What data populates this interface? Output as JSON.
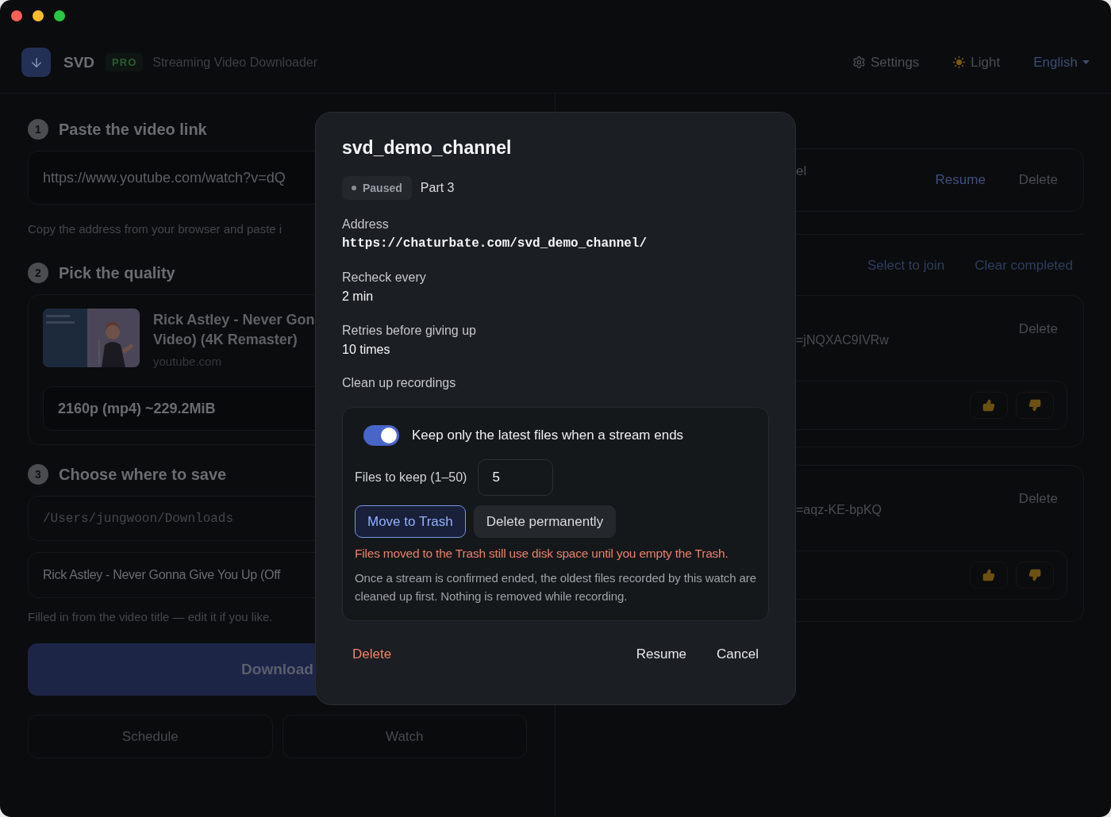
{
  "window": {
    "controls": [
      {
        "color": "#fe5f57"
      },
      {
        "color": "#febc2e"
      },
      {
        "color": "#28c840"
      }
    ]
  },
  "header": {
    "app_name": "SVD",
    "badge": "PRO",
    "tagline": "Streaming Video Downloader",
    "actions": [
      {
        "kind": "settings",
        "label": "Settings"
      },
      {
        "kind": "theme",
        "label": "Light"
      },
      {
        "kind": "language",
        "label": "English"
      }
    ]
  },
  "download_form": {
    "step_1": {
      "number": "1",
      "title": "Paste the video link",
      "url_value": "https://www.youtube.com/watch?v=dQ",
      "hint": "Copy the address from your browser and paste i"
    },
    "step_2": {
      "number": "2",
      "title": "Pick the quality",
      "video": {
        "thumbnail": {
          "kind": "picture"
        },
        "title_lines": [
          "Rick Astley - Never Gon",
          "Video) (4K Remaster)"
        ],
        "source": "youtube.com"
      },
      "format": "2160p (mp4) ~229.2MiB"
    },
    "step_3": {
      "number": "3",
      "title": "Choose where to save",
      "folder": "/Users/jungwoon/Downloads",
      "file_name": "Rick Astley - Never Gonna Give You Up (Off",
      "hint": "Filled in from the video title — edit it if you like."
    },
    "primary_button": "Download",
    "secondary_buttons": [
      "Schedule",
      "Watch"
    ]
  },
  "queue": {
    "watch_card": {
      "title_fragment": "el",
      "actions": [
        {
          "label": "Resume",
          "kind": "primary"
        },
        {
          "label": "Delete",
          "kind": "muted"
        }
      ]
    },
    "toolbar_actions": [
      "Select to join",
      "Clear completed"
    ],
    "items": [
      {
        "link_fragment": "=jNQXAC9IVRw",
        "action": "Delete"
      },
      {
        "link_fragment": "=aqz-KE-bpKQ",
        "action": "Delete"
      }
    ]
  },
  "dialog": {
    "title": "svd_demo_channel",
    "status": {
      "label": "Paused"
    },
    "part": "Part 3",
    "fields": [
      {
        "label": "Address",
        "value": "https://chaturbate.com/svd_demo_channel/",
        "kind": "mono"
      },
      {
        "label": "Recheck every",
        "value": "2 min",
        "kind": "text"
      },
      {
        "label": "Retries before giving up",
        "value": "10 times",
        "kind": "text"
      }
    ],
    "cleanup": {
      "label": "Clean up recordings",
      "toggle": {
        "label": "Keep only the latest files when a stream ends",
        "on": true
      },
      "keep_count": {
        "label": "Files to keep (1–50)",
        "value": "5"
      },
      "modes": [
        {
          "label": "Move to Trash",
          "selected": true
        },
        {
          "label": "Delete permanently",
          "selected": false
        }
      ],
      "warning": "Files moved to the Trash still use disk space until you empty the Trash.",
      "note": "Once a stream is confirmed ended, the oldest files recorded by this watch are cleaned up first. Nothing is removed while recording."
    },
    "buttons": [
      {
        "kind": "danger",
        "label": "Delete"
      },
      {
        "kind": "plain",
        "label": "Resume"
      },
      {
        "kind": "plain",
        "label": "Cancel"
      }
    ]
  }
}
